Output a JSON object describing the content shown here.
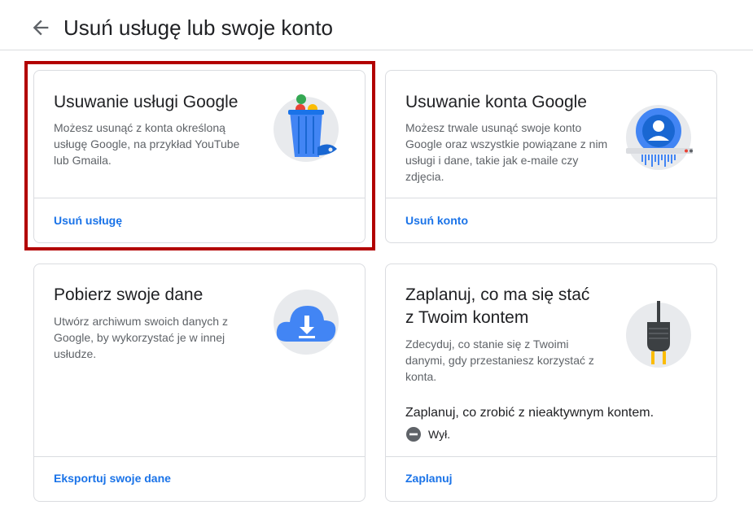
{
  "header": {
    "title": "Usuń usługę lub swoje konto"
  },
  "cards": {
    "delete_service": {
      "title": "Usuwanie usługi Google",
      "description": "Możesz usunąć z konta określoną usługę Google, na przykład YouTube lub Gmaila.",
      "link": "Usuń usługę"
    },
    "delete_account": {
      "title": "Usuwanie konta Google",
      "description": "Możesz trwale usunąć swoje konto Google oraz wszystkie powiązane z nim usługi i dane, takie jak e-maile czy zdjęcia.",
      "link": "Usuń konto"
    },
    "download_data": {
      "title": "Pobierz swoje dane",
      "description": "Utwórz archiwum swoich danych z Google, by wykorzystać je w innej usłudze.",
      "link": "Eksportuj swoje dane"
    },
    "plan_account": {
      "title_line1": "Zaplanuj, co ma się stać",
      "title_line2": "z Twoim kontem",
      "description": "Zdecyduj, co stanie się z Twoimi danymi, gdy przestaniesz korzystać z konta.",
      "inactive_label": "Zaplanuj, co zrobić z nieaktywnym kontem.",
      "status": "Wył.",
      "link": "Zaplanuj"
    }
  },
  "icons": {
    "back": "arrow-back-icon",
    "status_off": "minus-circle-icon"
  },
  "colors": {
    "accent_link": "#1a73e8",
    "highlight_border": "#b20000",
    "illustration_blue": "#4285f4"
  }
}
